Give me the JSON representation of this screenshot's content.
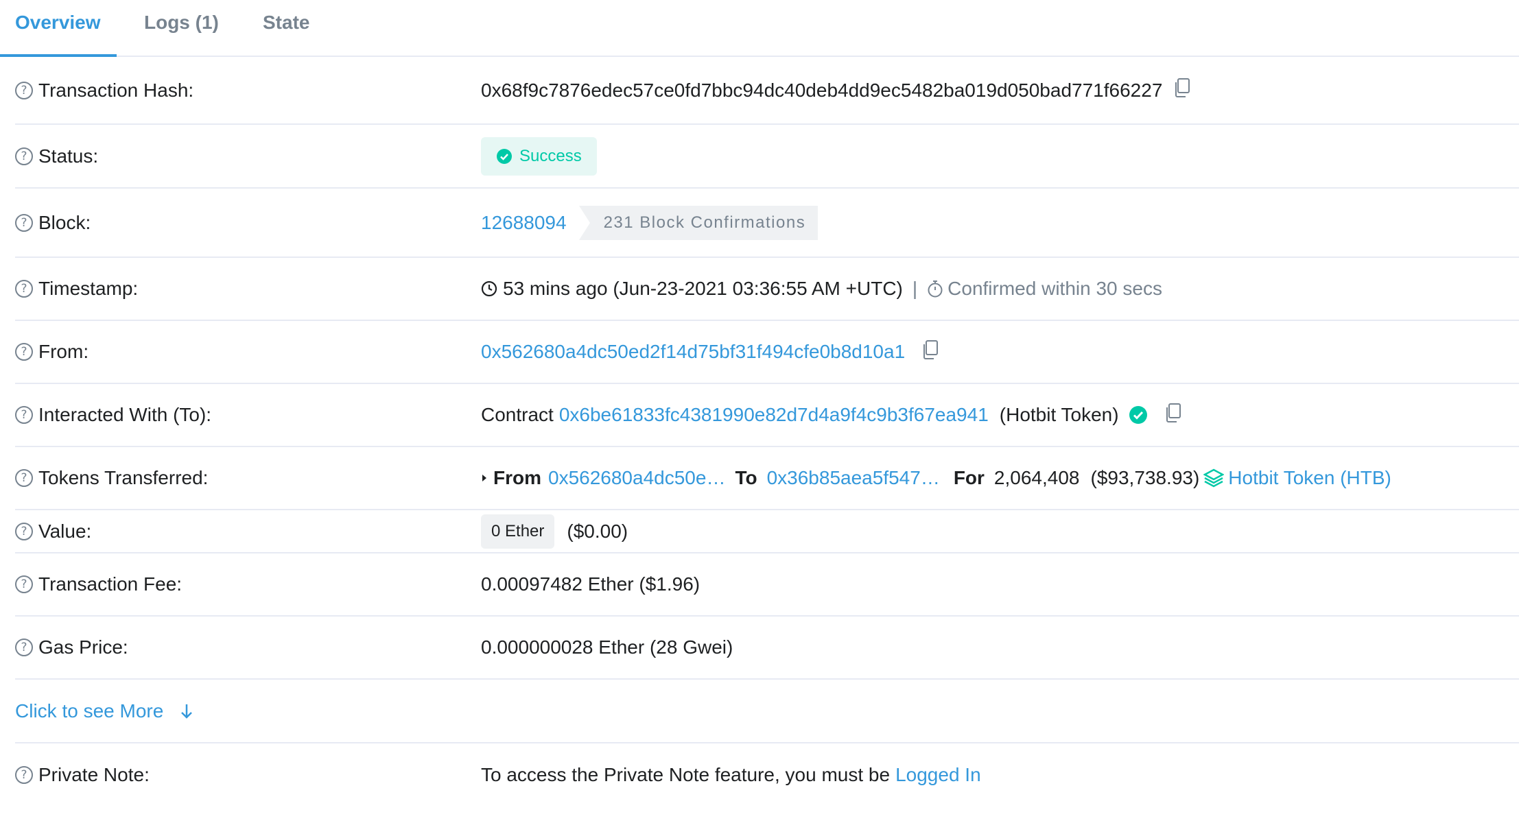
{
  "tabs": [
    {
      "label": "Overview"
    },
    {
      "label": "Logs (1)"
    },
    {
      "label": "State"
    }
  ],
  "rows": {
    "tx_hash": {
      "label": "Transaction Hash:",
      "value": "0x68f9c7876edec57ce0fd7bbc94dc40deb4dd9ec5482ba019d050bad771f66227"
    },
    "status": {
      "label": "Status:",
      "value": "Success"
    },
    "block": {
      "label": "Block:",
      "number": "12688094",
      "confirmations": "231 Block Confirmations"
    },
    "timestamp": {
      "label": "Timestamp:",
      "value": "53 mins ago (Jun-23-2021 03:36:55 AM +UTC)",
      "separator": "|",
      "confirmed": "Confirmed within 30 secs"
    },
    "from": {
      "label": "From:",
      "address": "0x562680a4dc50ed2f14d75bf31f494cfe0b8d10a1"
    },
    "interacted": {
      "label": "Interacted With (To):",
      "prefix": "Contract",
      "address": "0x6be61833fc4381990e82d7d4a9f4c9b3f67ea941",
      "name": "(Hotbit Token)"
    },
    "tokens": {
      "label": "Tokens Transferred:",
      "from_label": "From",
      "from_address": "0x562680a4dc50e…",
      "to_label": "To",
      "to_address": "0x36b85aea5f547…",
      "for_label": "For",
      "amount": "2,064,408",
      "usd": "($93,738.93)",
      "token_name": "Hotbit Token (HTB)"
    },
    "value": {
      "label": "Value:",
      "ether": "0 Ether",
      "usd": "($0.00)"
    },
    "fee": {
      "label": "Transaction Fee:",
      "value": "0.00097482 Ether ($1.96)"
    },
    "gas": {
      "label": "Gas Price:",
      "value": "0.000000028 Ether (28 Gwei)"
    },
    "more": {
      "label": "Click to see More"
    },
    "note": {
      "label": "Private Note:",
      "text": "To access the Private Note feature, you must be",
      "link": "Logged In"
    }
  },
  "colors": {
    "accent": "#3498db",
    "success": "#00c9a7",
    "muted": "#77838f",
    "border": "#e7eaf3"
  }
}
